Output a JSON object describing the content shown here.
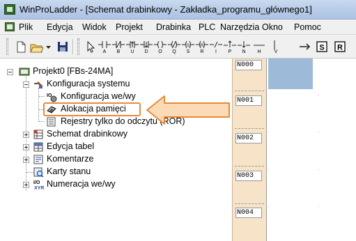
{
  "window": {
    "title": "WinProLadder - [Schemat drabinkowy - Zakładka_programu_głównego1]",
    "icon": "app-icon"
  },
  "menu": {
    "items": [
      "Plik",
      "Edycja",
      "Widok",
      "Projekt",
      "Drabinka",
      "PLC",
      "Narzędzia",
      "Okno",
      "Pomoc"
    ]
  },
  "toolbar": {
    "icons": [
      "new-file-icon",
      "open-folder-icon",
      "dropdown-arrow-icon",
      "save-icon",
      "select-arrow-icon",
      "contact-a-icon",
      "contact-b-icon",
      "contact-up-icon",
      "contact-down-icon",
      "coil-o-icon",
      "coil-q-icon",
      "coil-set-icon",
      "coil-reset-icon",
      "contact-i-icon",
      "contact-p-icon",
      "contact-n-icon",
      "horizontal-line-icon",
      "vertical-line-icon",
      "arrow-right-icon",
      "s-box-icon",
      "r-box-icon"
    ],
    "letters": [
      "A",
      "B",
      "U",
      "D",
      "O",
      "Q",
      "S",
      "R",
      "I",
      "P",
      "N",
      "H",
      "V"
    ]
  },
  "tree": {
    "root": "Projekt0 [FBs-24MA]",
    "items": [
      {
        "label": "Konfiguracja systemu",
        "icon": "system-config-icon",
        "expanded": true
      },
      {
        "label": "Konfiguracja we/wy",
        "icon": "io-config-icon"
      },
      {
        "label": "Alokacja pamięci",
        "icon": "memory-allocation-icon",
        "highlighted": true
      },
      {
        "label": "Rejestry tylko do odczytu (ROR)",
        "icon": "ror-registers-icon"
      },
      {
        "label": "Schemat drabinkowy",
        "icon": "ladder-diagram-icon",
        "expanded": false
      },
      {
        "label": "Edycja tabel",
        "icon": "table-edit-icon",
        "expanded": false
      },
      {
        "label": "Komentarze",
        "icon": "comments-icon",
        "expanded": false
      },
      {
        "label": "Karty stanu",
        "icon": "status-cards-icon"
      },
      {
        "label": "Numeracja we/wy",
        "icon": "io-numbering-icon",
        "expanded": false
      }
    ]
  },
  "networks": [
    "N000",
    "N001",
    "N002",
    "N003",
    "N004"
  ],
  "colors": {
    "highlight_border": "#e8893a",
    "arrow_fill": "#fbd7b0",
    "network_column": "#f6e3c8",
    "selection": "#9dbbd8"
  }
}
